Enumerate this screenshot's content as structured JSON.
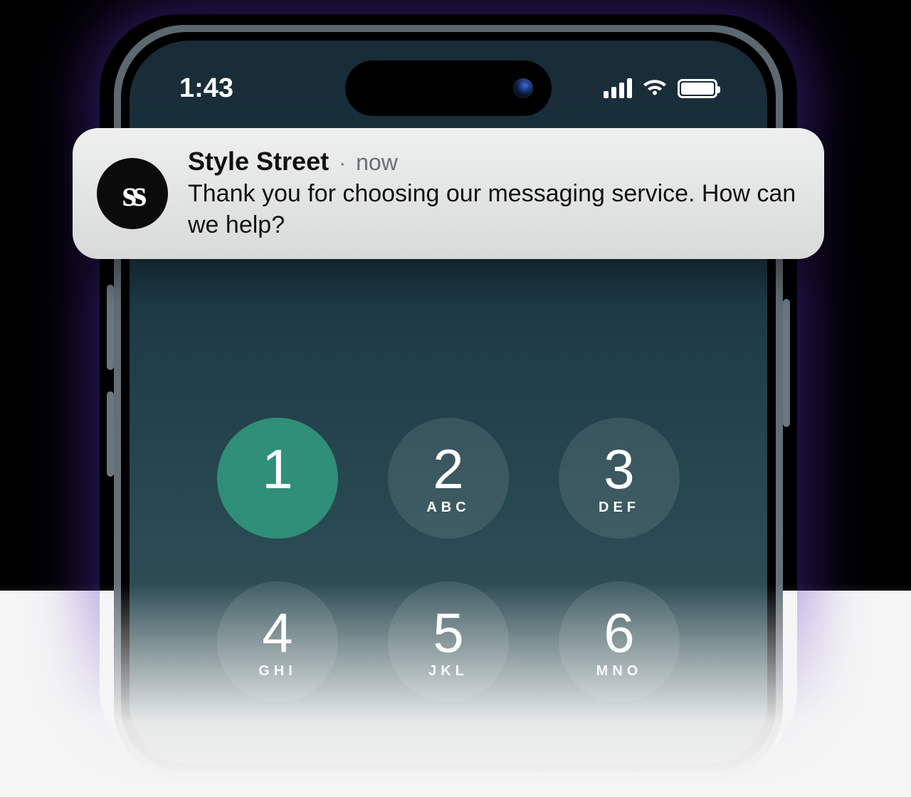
{
  "status": {
    "time": "1:43"
  },
  "notification": {
    "app_logo_text": "ss",
    "app_name": "Style Street",
    "separator": "·",
    "timestamp": "now",
    "message": "Thank you for choosing our messaging service. How can we help?"
  },
  "dialpad": {
    "keys": [
      {
        "digit": "1",
        "letters": "",
        "active": true
      },
      {
        "digit": "2",
        "letters": "ABC",
        "active": false
      },
      {
        "digit": "3",
        "letters": "DEF",
        "active": false
      },
      {
        "digit": "4",
        "letters": "GHI",
        "active": false
      },
      {
        "digit": "5",
        "letters": "JKL",
        "active": false
      },
      {
        "digit": "6",
        "letters": "MNO",
        "active": false
      }
    ]
  }
}
